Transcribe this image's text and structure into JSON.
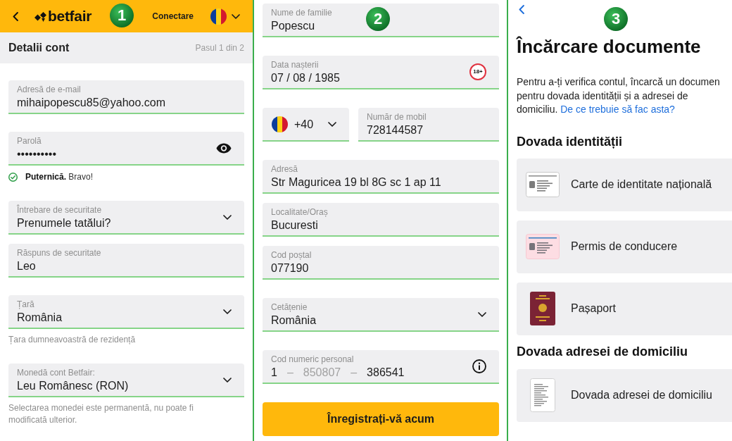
{
  "account_form": {
    "callout": "1",
    "top_bar": {
      "brand": "betfair",
      "login": "Conectare"
    },
    "step_bar": {
      "title": "Detalii cont",
      "step": "Pasul 1 din 2"
    },
    "groups": [
      [
        {
          "kind": "text",
          "label": "Adresă de e-mail",
          "value": "mihaipopescu85@yahoo.com",
          "valid": true
        }
      ],
      [
        {
          "kind": "password",
          "label": "Parolă",
          "value": "••••••••••",
          "valid": true,
          "strength": "**Puternică.** Bravo!"
        }
      ],
      [
        {
          "kind": "select",
          "label": "Întrebare de securitate",
          "value": "Prenumele tatălui?",
          "valid": true
        },
        {
          "kind": "text",
          "label": "Răspuns de securitate",
          "value": "Leo",
          "valid": true
        }
      ],
      [
        {
          "kind": "select",
          "label": "Țară",
          "value": "România",
          "valid": true,
          "hint": "Țara dumneavoastră de rezidență"
        }
      ],
      [
        {
          "kind": "select",
          "label": "Monedă cont Betfair:",
          "value": "Leu Românesc (RON)",
          "valid": true,
          "hint": "Selectarea monedei este permanentă, nu poate fi modificată ulterior."
        }
      ]
    ]
  },
  "personal_form": {
    "callout": "2",
    "groups": [
      [
        {
          "kind": "text",
          "label": "Nume de familie",
          "value": "Popescu",
          "valid": true
        }
      ],
      [
        {
          "kind": "date",
          "label": "Data nașterii",
          "value": "07 / 08 / 1985",
          "badge": "18+",
          "valid": true
        }
      ],
      [
        {
          "kind": "phone",
          "code": "+40",
          "code_valid": true,
          "label": "Număr de mobil",
          "value": "728144587",
          "valid": true
        }
      ],
      [
        {
          "kind": "text",
          "label": "Adresă",
          "value": "Str Maguricea 19 bl 8G sc 1 ap 11",
          "valid": true
        },
        {
          "kind": "text",
          "label": "Localitate/Oraș",
          "value": "Bucuresti",
          "valid": true
        },
        {
          "kind": "text",
          "label": "Cod poștal",
          "value": "077190",
          "valid": true
        }
      ],
      [
        {
          "kind": "select",
          "label": "Cetățenie",
          "value": "România",
          "valid": true
        }
      ],
      [
        {
          "kind": "cnp",
          "label": "Cod numeric personal",
          "valid": true,
          "parts": [
            {
              "text": "1",
              "muted": false
            },
            {
              "text": "–",
              "muted": true
            },
            {
              "text": "850807",
              "muted": true
            },
            {
              "text": "–",
              "muted": true
            },
            {
              "text": "386541",
              "muted": false
            }
          ]
        }
      ]
    ],
    "submit": "Înregistrați-vă acum"
  },
  "documents": {
    "callout": "3",
    "title": "Încărcare documente",
    "intro": "Pentru a-ți verifica contul, încarcă un documen pentru dovada identității și a adresei de domiciliu.",
    "intro_link": "De ce trebuie să fac asta?",
    "sections": [
      {
        "heading": "Dovada identității",
        "options": [
          {
            "kind": "id_card",
            "label": "Carte de identitate națională"
          },
          {
            "kind": "licence",
            "label": "Permis de conducere"
          },
          {
            "kind": "passport",
            "label": "Pașaport"
          }
        ]
      },
      {
        "heading": "Dovada adresei de domiciliu",
        "options": [
          {
            "kind": "document",
            "label": "Dovada adresei de domiciliu"
          }
        ]
      }
    ]
  }
}
